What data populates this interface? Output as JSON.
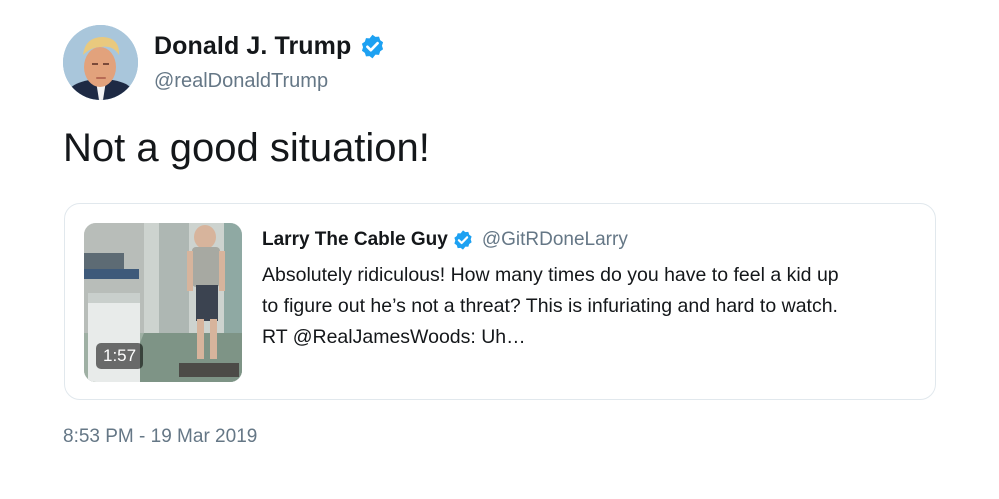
{
  "author": {
    "display_name": "Donald J. Trump",
    "handle": "@realDonaldTrump",
    "verified": true
  },
  "tweet": {
    "text": "Not a good situation!",
    "timestamp": "8:53 PM - 19 Mar 2019"
  },
  "quoted_tweet": {
    "display_name": "Larry The Cable Guy",
    "handle": "@GitRDoneLarry",
    "verified": true,
    "text_lines": [
      "Absolutely ridiculous! How many times do you have to feel a kid up",
      "to figure out he’s not a threat? This is infuriating and hard to watch.",
      "RT @RealJamesWoods: Uh…"
    ],
    "media": {
      "type": "video",
      "duration": "1:57"
    }
  },
  "icons": {
    "verified": "verified-badge-icon",
    "play": "video-thumbnail"
  },
  "colors": {
    "verified_blue": "#1da1f2",
    "secondary_text": "#657786",
    "border": "#e1e8ed"
  }
}
